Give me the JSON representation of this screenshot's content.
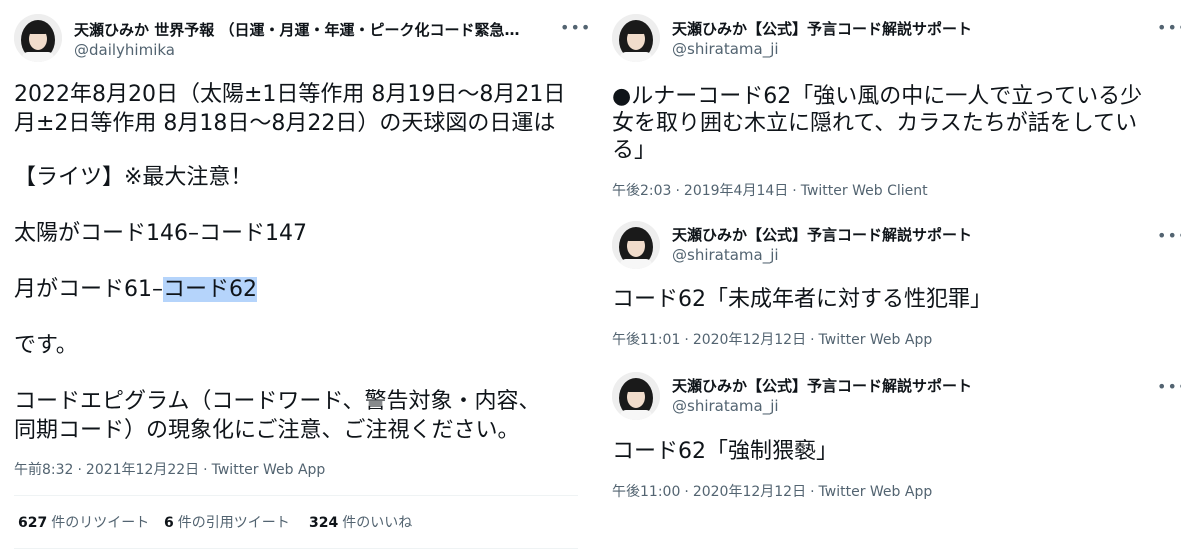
{
  "left_tweet": {
    "display_name": "天瀬ひみか 世界予報 （日運・月運・年運・ピーク化コード緊急警…",
    "handle": "@dailyhimika",
    "lines": [
      "2022年8月20日（太陽±1日等作用 8月19日〜8月21日",
      "月±2日等作用 8月18日〜8月22日）の天球図の日運は",
      "【ライツ】※最大注意！",
      "太陽がコード146–コード147",
      "月がコード61–",
      "コード62",
      "です。",
      "コードエピグラム（コードワード、警告対象・内容、",
      "同期コード）の現象化にご注意、ご注視ください。"
    ],
    "time": "午前8:32",
    "date": "2021年12月22日",
    "client": "Twitter Web App",
    "stats": {
      "retweets_count": "627",
      "retweets_label": "件のリツイート",
      "quotes_count": "6",
      "quotes_label": "件の引用ツイート",
      "likes_count": "324",
      "likes_label": "件のいいね"
    }
  },
  "right_tweets": [
    {
      "display_name": "天瀬ひみか【公式】予言コード解説サポート",
      "handle": "@shiratama_ji",
      "lines": [
        "●ルナーコード62「強い風の中に一人で立っている少",
        "女を取り囲む木立に隠れて、カラスたちが話をしてい",
        "る」"
      ],
      "time": "午後2:03",
      "date": "2019年4月14日",
      "client": "Twitter Web Client"
    },
    {
      "display_name": "天瀬ひみか【公式】予言コード解説サポート",
      "handle": "@shiratama_ji",
      "lines": [
        "コード62「未成年者に対する性犯罪」"
      ],
      "time": "午後11:01",
      "date": "2020年12月12日",
      "client": "Twitter Web App"
    },
    {
      "display_name": "天瀬ひみか【公式】予言コード解説サポート",
      "handle": "@shiratama_ji",
      "lines": [
        "コード62「強制猥褻」"
      ],
      "time": "午後11:00",
      "date": "2020年12月12日",
      "client": "Twitter Web App"
    }
  ],
  "meta_separator": "·",
  "more_icon": "more-horizontal-icon",
  "colors": {
    "text": "#0f1419",
    "secondary": "#536471",
    "highlight": "#b5d4fb",
    "divider": "#eff3f4"
  }
}
